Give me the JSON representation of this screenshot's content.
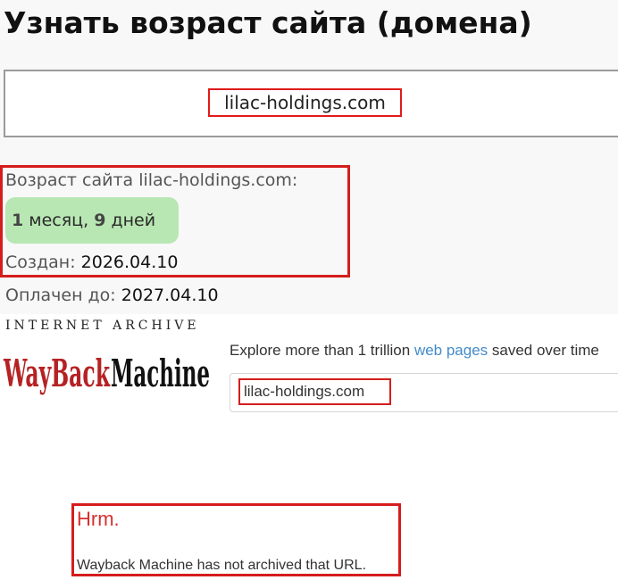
{
  "domain_age": {
    "title": "Узнать возраст сайта (домена)",
    "query_domain": "lilac-holdings.com",
    "age_label": "Возраст сайта lilac-holdings.com:",
    "age": {
      "months_number": "1",
      "months_word": " месяц, ",
      "days_number": "9",
      "days_word": " дней"
    },
    "created_label": "Создан:",
    "created_value": "2026.04.10",
    "paid_label": "Оплачен до:",
    "paid_value": "2027.04.10",
    "badge_color": "#b8e7b3"
  },
  "wayback": {
    "caption": "INTERNET ARCHIVE",
    "logo_text": {
      "red_part": "WayBack",
      "black_part": "Machine"
    },
    "explore": {
      "prefix": "Explore more than 1 trillion ",
      "link": "web pages",
      "suffix": " saved over time"
    },
    "search_value": "lilac-holdings.com",
    "error_title": "Hrm.",
    "error_message": "Wayback Machine has not archived that URL."
  },
  "highlight_color": "#d51d1d"
}
